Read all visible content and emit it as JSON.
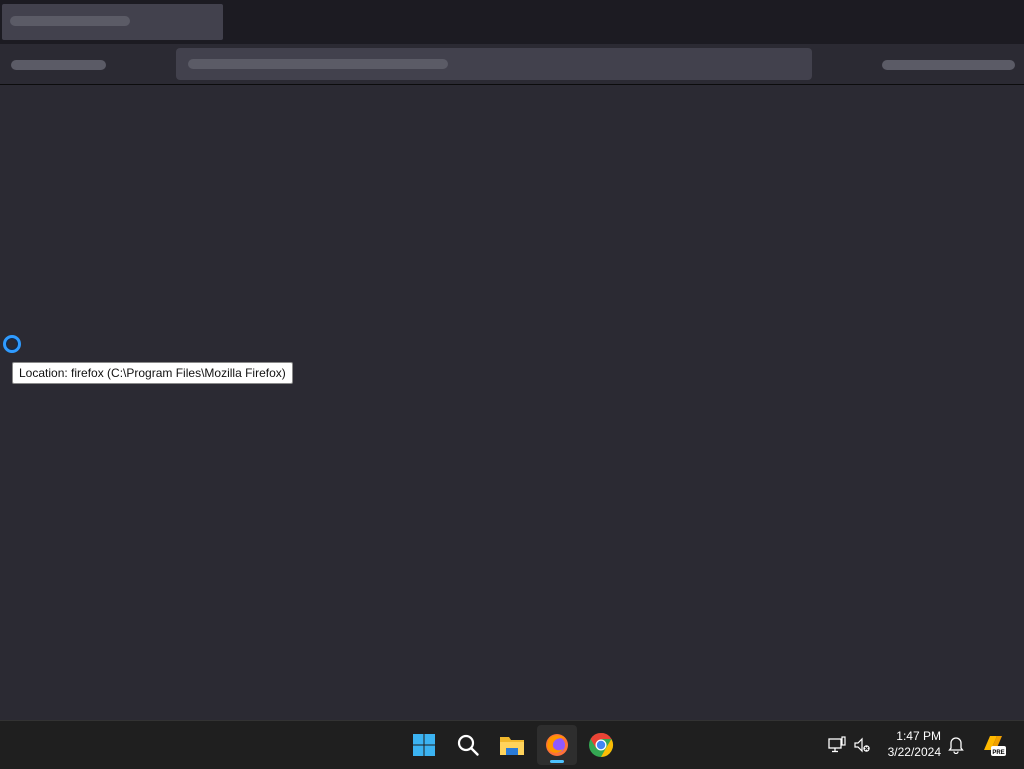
{
  "tooltip": {
    "text": "Location: firefox (C:\\Program Files\\Mozilla Firefox)"
  },
  "taskbar": {
    "items": [
      {
        "name": "Start",
        "icon": "windows-logo-icon"
      },
      {
        "name": "Search",
        "icon": "search-icon"
      },
      {
        "name": "File Explorer",
        "icon": "folder-icon"
      },
      {
        "name": "Firefox",
        "icon": "firefox-icon",
        "active": true
      },
      {
        "name": "Chrome",
        "icon": "chrome-icon"
      }
    ],
    "accent": "#4cc2ff"
  },
  "clock": {
    "time": "1:47 PM",
    "date": "3/22/2024"
  },
  "colors": {
    "background": "#2b2a33",
    "tabstrip": "#1c1b22",
    "placeholder": "#5b5b66"
  }
}
